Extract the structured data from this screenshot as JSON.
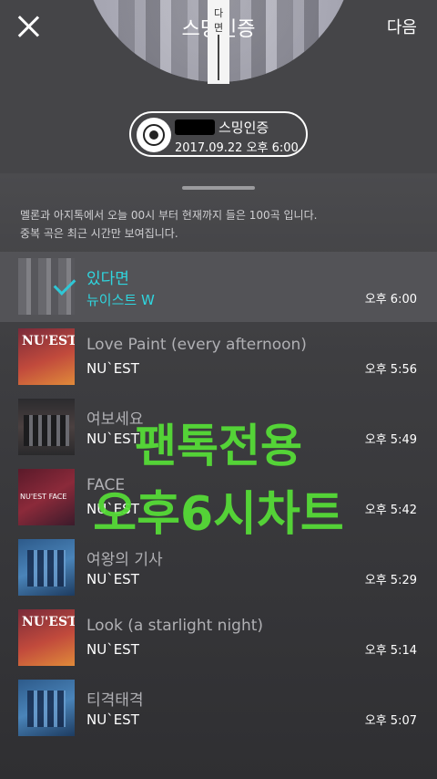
{
  "header": {
    "title": "스밍인증",
    "next_label": "다음",
    "bookmark_char1": "다",
    "bookmark_char2": "면"
  },
  "badge": {
    "title": "스밍인증",
    "time": "2017.09.22 오후 6:00"
  },
  "notice": {
    "line1": "멜론과 아지톡에서 오늘 00시 부터 현재까지 들은 100곡 입니다.",
    "line2": "중복 곡은 최근 시간만 보여집니다."
  },
  "songs": [
    {
      "title": "있다면",
      "artist": "뉴이스트 W",
      "time": "오후 6:00",
      "selected": true
    },
    {
      "title": "Love Paint (every afternoon)",
      "artist": "NU`EST",
      "time": "오후 5:56"
    },
    {
      "title": "여보세요",
      "artist": "NU`EST",
      "time": "오후 5:49"
    },
    {
      "title": "FACE",
      "artist": "NU`EST",
      "time": "오후 5:42"
    },
    {
      "title": "여왕의 기사",
      "artist": "NU`EST",
      "time": "오후 5:29"
    },
    {
      "title": "Look (a starlight night)",
      "artist": "NU`EST",
      "time": "오후 5:14"
    },
    {
      "title": "티격태격",
      "artist": "NU`EST",
      "time": "오후 5:07"
    }
  ],
  "watermark": {
    "line1": "팬톡전용",
    "line2": "오후6시차트"
  },
  "colors": {
    "accent": "#2fd6df",
    "watermark": "#57e037"
  }
}
